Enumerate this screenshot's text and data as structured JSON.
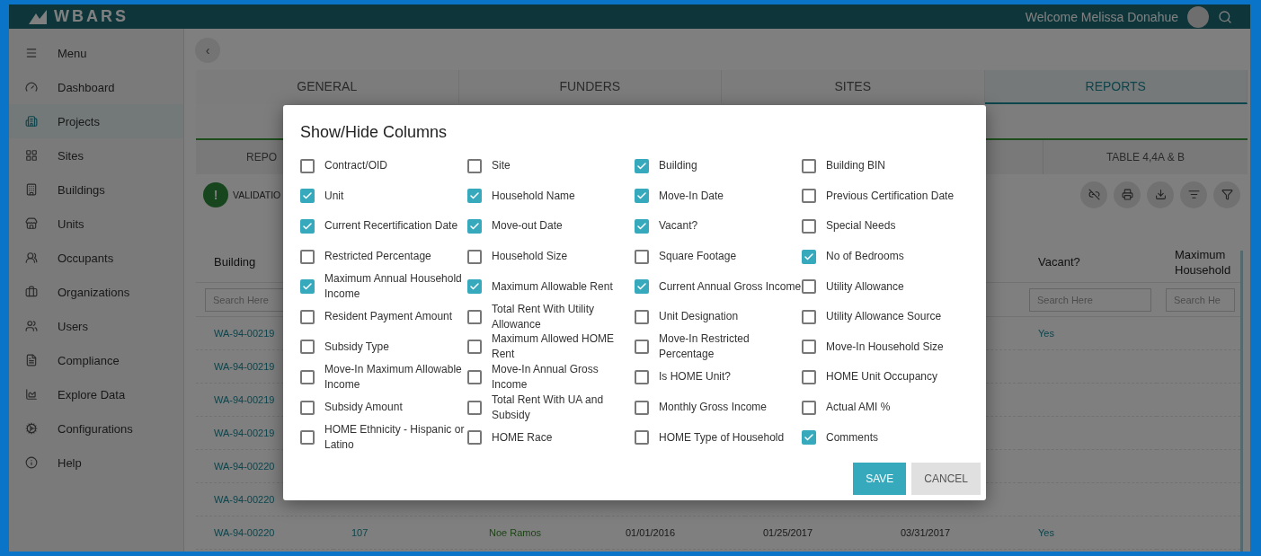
{
  "header": {
    "logo": "WBARS",
    "welcome": "Welcome Melissa Donahue"
  },
  "sidebar": {
    "items": [
      {
        "label": "Menu",
        "selected": false
      },
      {
        "label": "Dashboard",
        "selected": false
      },
      {
        "label": "Projects",
        "selected": true
      },
      {
        "label": "Sites",
        "selected": false
      },
      {
        "label": "Buildings",
        "selected": false
      },
      {
        "label": "Units",
        "selected": false
      },
      {
        "label": "Occupants",
        "selected": false
      },
      {
        "label": "Organizations",
        "selected": false
      },
      {
        "label": "Users",
        "selected": false
      },
      {
        "label": "Compliance",
        "selected": false
      },
      {
        "label": "Explore Data",
        "selected": false
      },
      {
        "label": "Configurations",
        "selected": false
      },
      {
        "label": "Help",
        "selected": false
      }
    ]
  },
  "back_button": "‹",
  "tabs": [
    {
      "label": "GENERAL",
      "selected": false
    },
    {
      "label": "FUNDERS",
      "selected": false
    },
    {
      "label": "SITES",
      "selected": false
    },
    {
      "label": "REPORTS",
      "selected": true
    }
  ],
  "sub_tabs": [
    {
      "label": "REPO"
    },
    {
      "label": "TABLE 4,4A & B"
    }
  ],
  "validation": {
    "icon": "!",
    "label": "VALIDATIO"
  },
  "table": {
    "columns": [
      {
        "header": "Building",
        "placeholder": "Search Here"
      },
      {},
      {},
      {},
      {},
      {},
      {
        "header": "Vacant?",
        "placeholder": "Search Here"
      },
      {
        "header": "Maximum Household",
        "placeholder": "Search He"
      }
    ],
    "rows": [
      {
        "cells": [
          "WA-94-00219",
          "",
          "",
          "",
          "",
          "",
          "Yes",
          ""
        ]
      },
      {
        "cells": [
          "WA-94-00219",
          "",
          "",
          "",
          "",
          "",
          "",
          ""
        ]
      },
      {
        "cells": [
          "WA-94-00219",
          "",
          "",
          "",
          "",
          "",
          "",
          ""
        ]
      },
      {
        "cells": [
          "WA-94-00219",
          "",
          "",
          "",
          "",
          "",
          "",
          ""
        ]
      },
      {
        "cells": [
          "WA-94-00220",
          "",
          "",
          "",
          "",
          "",
          "",
          ""
        ]
      },
      {
        "cells": [
          "WA-94-00220",
          "",
          "",
          "",
          "",
          "",
          "",
          ""
        ]
      },
      {
        "cells": [
          "WA-94-00220",
          "107",
          "Noe Ramos",
          "01/01/2016",
          "01/25/2017",
          "03/31/2017",
          "Yes",
          ""
        ]
      }
    ]
  },
  "dialog": {
    "title": "Show/Hide Columns",
    "options": [
      {
        "label": "Contract/OID",
        "checked": false
      },
      {
        "label": "Site",
        "checked": false
      },
      {
        "label": "Building",
        "checked": true
      },
      {
        "label": "Building BIN",
        "checked": false
      },
      {
        "label": "Unit",
        "checked": true
      },
      {
        "label": "Household Name",
        "checked": true
      },
      {
        "label": "Move-In Date",
        "checked": true
      },
      {
        "label": "Previous Certification Date",
        "checked": false
      },
      {
        "label": "Current Recertification Date",
        "checked": true
      },
      {
        "label": "Move-out Date",
        "checked": true
      },
      {
        "label": "Vacant?",
        "checked": true
      },
      {
        "label": "Special Needs",
        "checked": false
      },
      {
        "label": "Restricted Percentage",
        "checked": false
      },
      {
        "label": "Household Size",
        "checked": false
      },
      {
        "label": "Square Footage",
        "checked": false
      },
      {
        "label": "No of Bedrooms",
        "checked": true
      },
      {
        "label": "Maximum Annual Household Income",
        "checked": true
      },
      {
        "label": "Maximum Allowable Rent",
        "checked": true
      },
      {
        "label": "Current Annual Gross Income",
        "checked": true
      },
      {
        "label": "Utility Allowance",
        "checked": false
      },
      {
        "label": "Resident Payment Amount",
        "checked": false
      },
      {
        "label": "Total Rent With Utility Allowance",
        "checked": false
      },
      {
        "label": "Unit Designation",
        "checked": false
      },
      {
        "label": "Utility Allowance Source",
        "checked": false
      },
      {
        "label": "Subsidy Type",
        "checked": false
      },
      {
        "label": "Maximum Allowed HOME Rent",
        "checked": false
      },
      {
        "label": "Move-In Restricted Percentage",
        "checked": false
      },
      {
        "label": "Move-In Household Size",
        "checked": false
      },
      {
        "label": "Move-In Maximum Allowable Income",
        "checked": false
      },
      {
        "label": "Move-In Annual Gross Income",
        "checked": false
      },
      {
        "label": "Is HOME Unit?",
        "checked": false
      },
      {
        "label": "HOME Unit Occupancy",
        "checked": false
      },
      {
        "label": "Subsidy Amount",
        "checked": false
      },
      {
        "label": "Total Rent With UA and Subsidy",
        "checked": false
      },
      {
        "label": "Monthly Gross Income",
        "checked": false
      },
      {
        "label": "Actual AMI %",
        "checked": false
      },
      {
        "label": "HOME Ethnicity - Hispanic or Latino",
        "checked": false
      },
      {
        "label": "HOME Race",
        "checked": false
      },
      {
        "label": "HOME Type of Household",
        "checked": false
      },
      {
        "label": "Comments",
        "checked": true
      }
    ],
    "buttons": [
      {
        "label": "SAVE",
        "kind": "primary"
      },
      {
        "label": "CANCEL",
        "kind": "secondary"
      }
    ]
  }
}
